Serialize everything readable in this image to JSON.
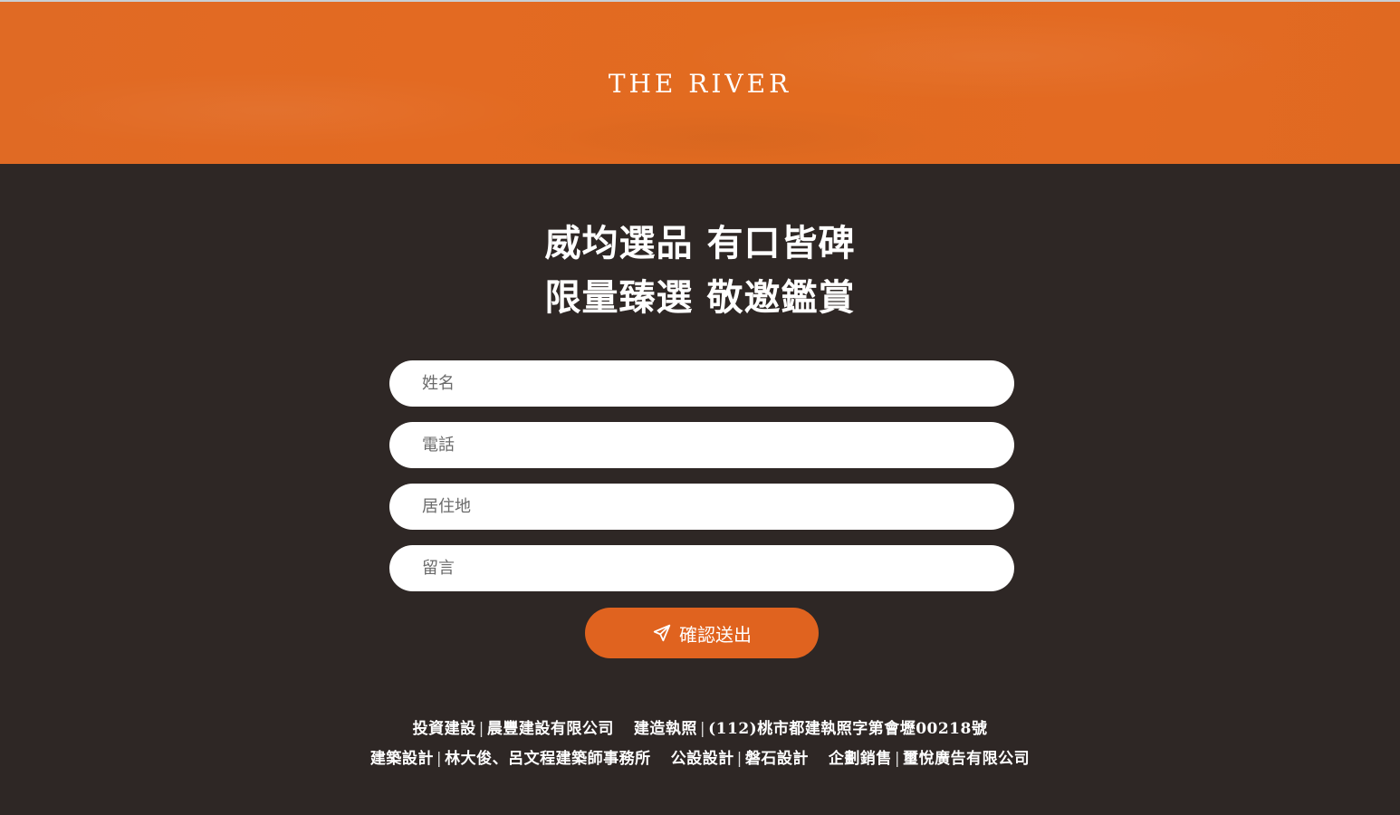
{
  "header": {
    "brand": "THE RIVER"
  },
  "headline": {
    "line1": "威均選品 有口皆碑",
    "line2": "限量臻選 敬邀鑑賞"
  },
  "form": {
    "name_placeholder": "姓名",
    "phone_placeholder": "電話",
    "residence_placeholder": "居住地",
    "message_placeholder": "留言",
    "submit_label": "確認送出",
    "submit_icon": "paper-plane-icon"
  },
  "footer": {
    "investor_label": "投資建設",
    "investor_value": "晨豐建設有限公司",
    "permit_label": "建造執照",
    "permit_value": "(112)桃市都建執照字第會壢00218號",
    "architect_label": "建築設計",
    "architect_value": "林大俊、呂文程建築師事務所",
    "public_design_label": "公設設計",
    "public_design_value": "磐石設計",
    "sales_label": "企劃銷售",
    "sales_value": "璽悅廣告有限公司"
  },
  "colors": {
    "accent": "#e0631f",
    "background": "#2e2725"
  }
}
